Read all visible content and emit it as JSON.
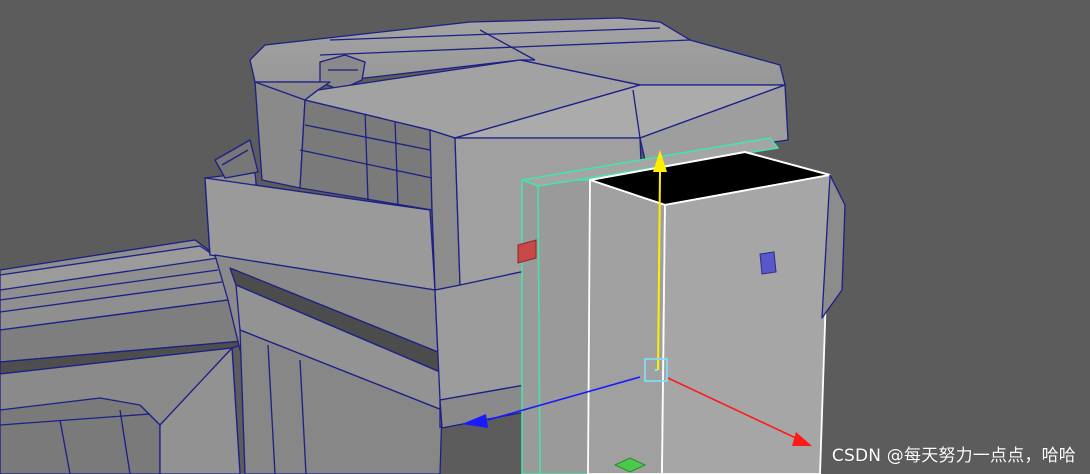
{
  "viewport": {
    "background": "#5c5c5c",
    "wireframe_color": "#1b1f86",
    "selection_color": "#44e6a8",
    "highlight_color": "#ffffff"
  },
  "gizmo": {
    "y_axis_color": "#ffee00",
    "x_axis_color": "#ff1a1a",
    "z_axis_color": "#1a1aff",
    "center_color": "#7fe0ff",
    "handle_yz_color": "#5a58c8",
    "handle_xy_color": "#c84848",
    "handle_xz_color": "#4cc84c"
  },
  "watermark": {
    "text": "CSDN @每天努力一点点，哈哈"
  }
}
